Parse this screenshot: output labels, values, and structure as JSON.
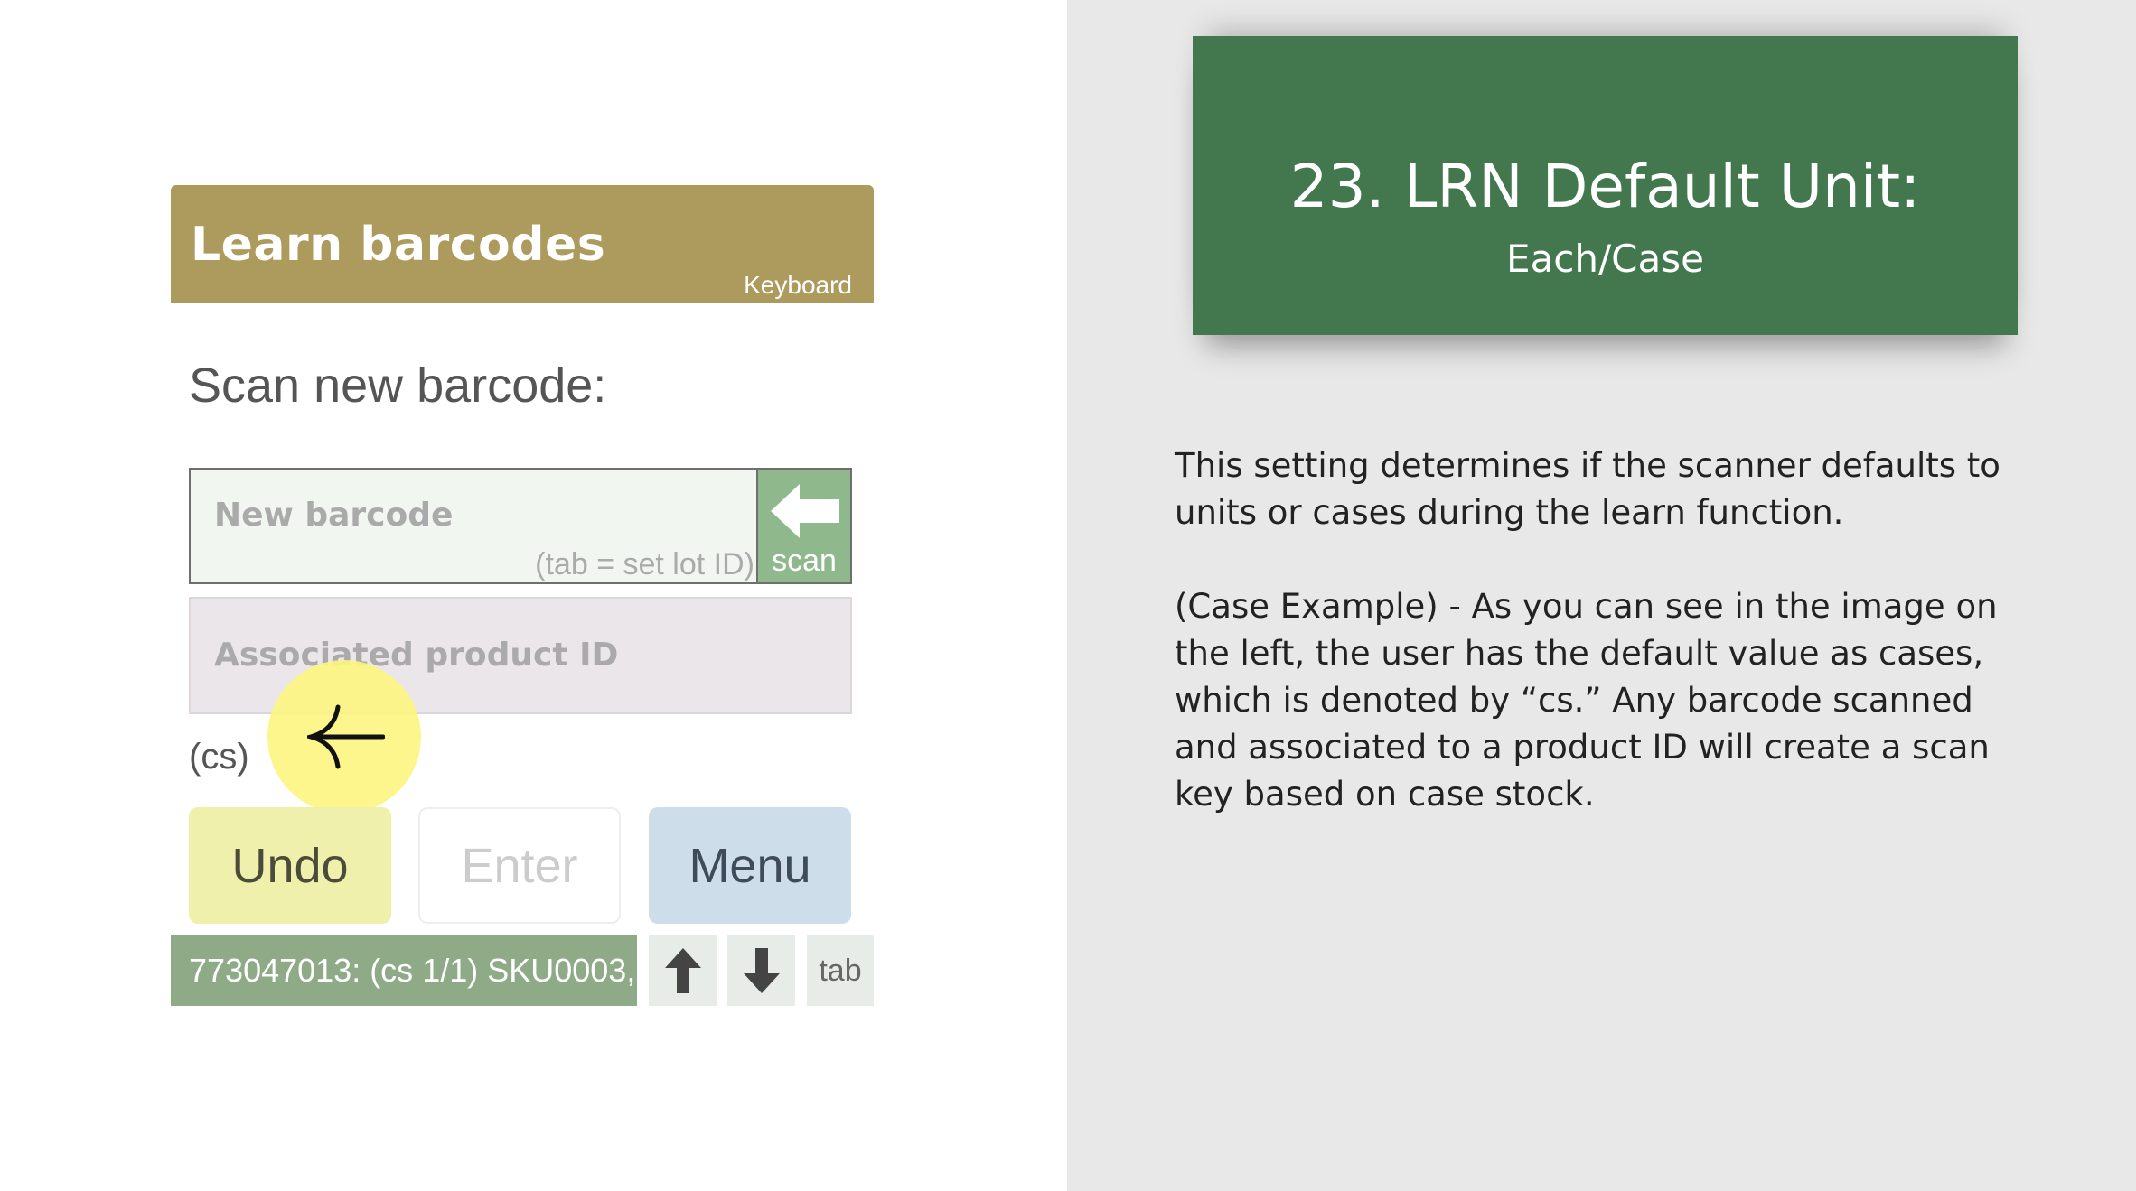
{
  "app": {
    "title": "Learn barcodes",
    "keyboard_label": "Keyboard",
    "scan_prompt": "Scan new barcode:",
    "barcode_input": {
      "placeholder": "New barcode",
      "hint": "(tab = set lot ID)"
    },
    "scan_button": {
      "label": "scan",
      "icon": "arrow-left-icon"
    },
    "product_input": {
      "placeholder": "Associated product ID"
    },
    "unit_label": "(cs)",
    "buttons": {
      "undo": "Undo",
      "enter": "Enter",
      "menu": "Menu"
    },
    "status_text": "773047013: (cs 1/1) SKU0003,",
    "keys": {
      "up": "up-arrow-icon",
      "down": "down-arrow-icon",
      "tab": "tab"
    },
    "colors": {
      "header": "#ad9a5d",
      "scan": "#8fb98c",
      "status": "#8faa87",
      "undo": "#eef0ab",
      "menu": "#cddde9",
      "touch": "#fcf580"
    }
  },
  "info": {
    "title": "23. LRN Default Unit:",
    "subtitle": "Each/Case",
    "paragraph1": "This setting determines if the scanner defaults to units or cases during the learn function.",
    "paragraph2": "(Case Example) - As you can see in the image on the left, the user has the default value as cases, which is denoted by “cs.” Any barcode scanned and associated to a product ID will create a scan key based on case stock.",
    "colors": {
      "card": "#43784f",
      "background": "#e8e8e8"
    }
  }
}
